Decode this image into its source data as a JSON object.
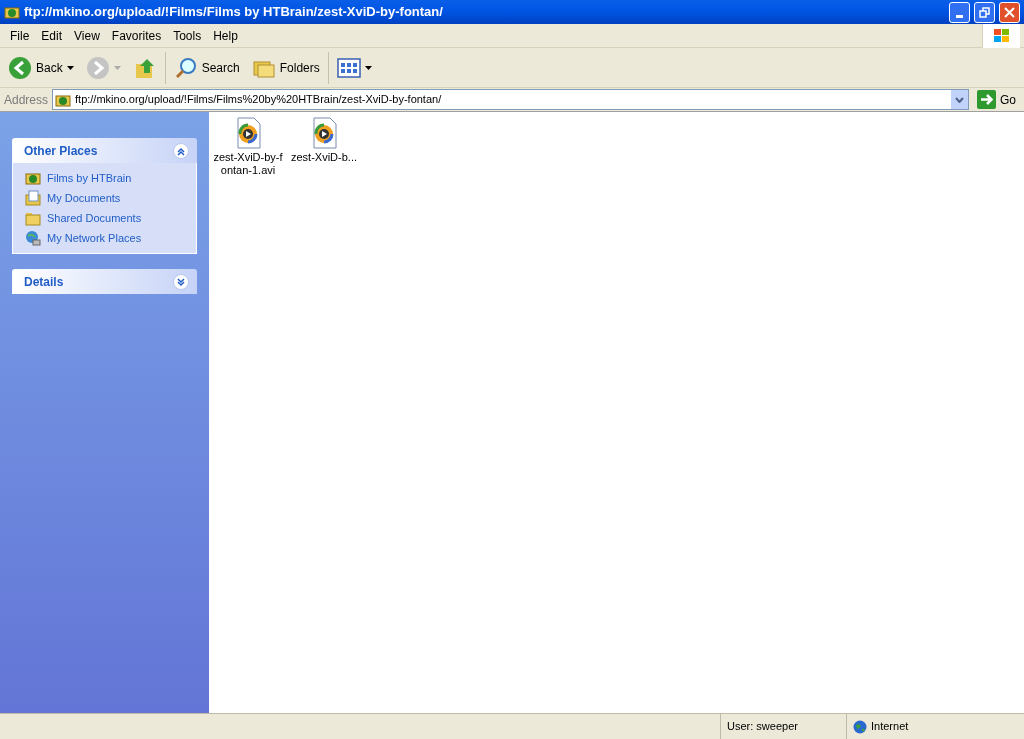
{
  "window": {
    "title": "ftp://mkino.org/upload/!Films/Films by HTBrain/zest-XviD-by-fontan/"
  },
  "menu": [
    "File",
    "Edit",
    "View",
    "Favorites",
    "Tools",
    "Help"
  ],
  "toolbar": [
    {
      "kind": "back",
      "label": "Back",
      "disabled": false
    },
    {
      "kind": "forward",
      "disabled": true
    },
    {
      "kind": "up"
    },
    {
      "kind": "search",
      "label": "Search"
    },
    {
      "kind": "folders",
      "label": "Folders"
    },
    {
      "kind": "views"
    }
  ],
  "address": {
    "label": "Address",
    "value": "ftp://mkino.org/upload/!Films/Films%20by%20HTBrain/zest-XviD-by-fontan/",
    "go": "Go"
  },
  "panels": [
    {
      "title": "Other Places",
      "expanded": true,
      "items": [
        {
          "kind": "ftp",
          "label": "Films by HTBrain"
        },
        {
          "kind": "documents",
          "label": "My Documents"
        },
        {
          "kind": "folder",
          "label": "Shared Documents"
        },
        {
          "kind": "network",
          "label": "My Network Places"
        }
      ]
    },
    {
      "title": "Details",
      "expanded": false
    }
  ],
  "files": [
    {
      "name": "zest-XviD-by-fontan-1.avi"
    },
    {
      "name": "zest-XviD-b..."
    }
  ],
  "status_bar": {
    "user": "User: sweeper",
    "zone": "Internet"
  }
}
